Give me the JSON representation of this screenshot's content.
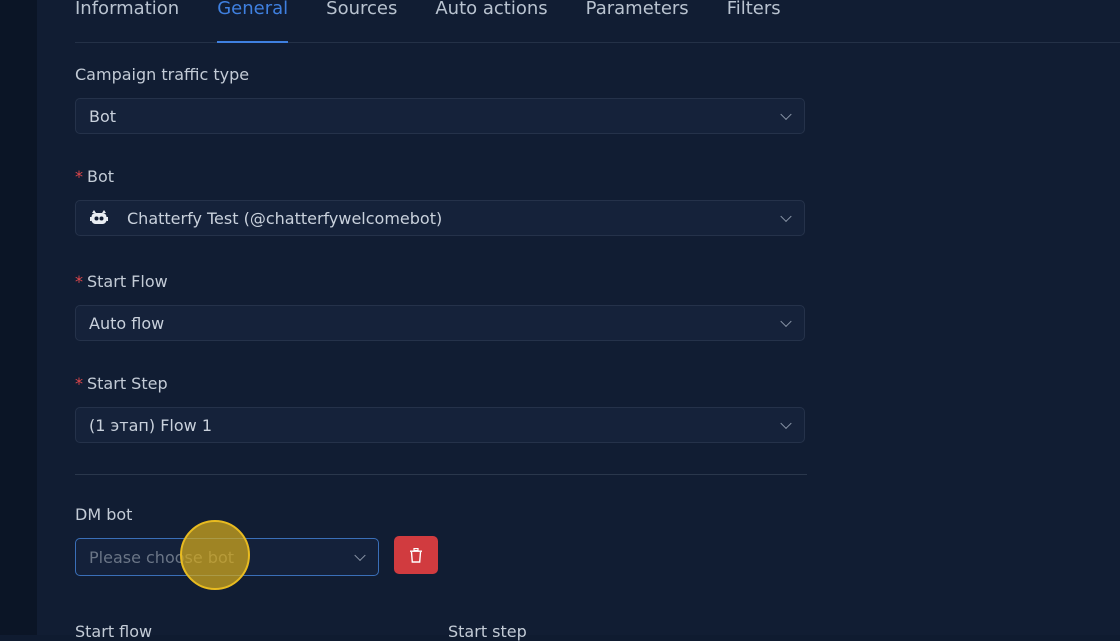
{
  "tabs": [
    {
      "label": "Information"
    },
    {
      "label": "General"
    },
    {
      "label": "Sources"
    },
    {
      "label": "Auto actions"
    },
    {
      "label": "Parameters"
    },
    {
      "label": "Filters"
    }
  ],
  "active_tab": "General",
  "form": {
    "traffic_type": {
      "label": "Campaign traffic type",
      "value": "Bot"
    },
    "bot": {
      "required_mark": "*",
      "label": "Bot",
      "value": "Chatterfy Test (@chatterfywelcomebot)",
      "icon": "bot-icon"
    },
    "start_flow": {
      "required_mark": "*",
      "label": "Start Flow",
      "value": "Auto flow"
    },
    "start_step": {
      "required_mark": "*",
      "label": "Start Step",
      "value": "(1 этап) Flow 1"
    },
    "dm_bot": {
      "label": "DM bot",
      "placeholder": "Please choose bot"
    },
    "bottom": {
      "start_flow_label": "Start flow",
      "start_step_label": "Start step"
    }
  },
  "colors": {
    "accent": "#3f80e0",
    "danger": "#d13b3f",
    "required": "#e0474c"
  }
}
